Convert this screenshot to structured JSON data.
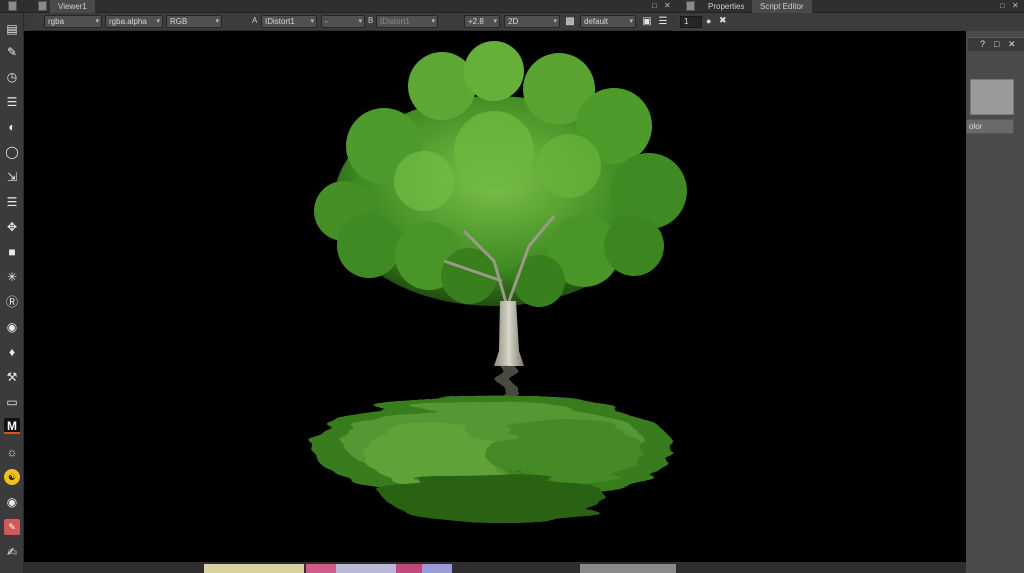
{
  "tabs": {
    "viewer": "Viewer1",
    "properties": "Properties",
    "script_editor": "Script Editor"
  },
  "toolbar": {
    "channels": "rgba",
    "alpha_channel": "rgba.alpha",
    "display": "RGB",
    "a_label": "A",
    "a_input": "IDistort1",
    "operator": "-",
    "b_label": "B",
    "b_input": "IDistort1",
    "gain": "+2.8",
    "view_mode": "2D",
    "lut": "default"
  },
  "properties_toolbar": {
    "max_panels": "1"
  },
  "right_panel": {
    "color_button": "olor"
  },
  "icons": {
    "viewer_tab_grip": "grip-icon",
    "float_window": "float-icon",
    "close_window": "close-icon",
    "clapper": "clapperboard-icon",
    "roi": "roi-icon",
    "menu": "menu-icon",
    "help": "help-icon"
  },
  "colors": {
    "canvas": "#000000",
    "ui_background": "#3a3a3a",
    "accent_orange": "#e0501c"
  }
}
